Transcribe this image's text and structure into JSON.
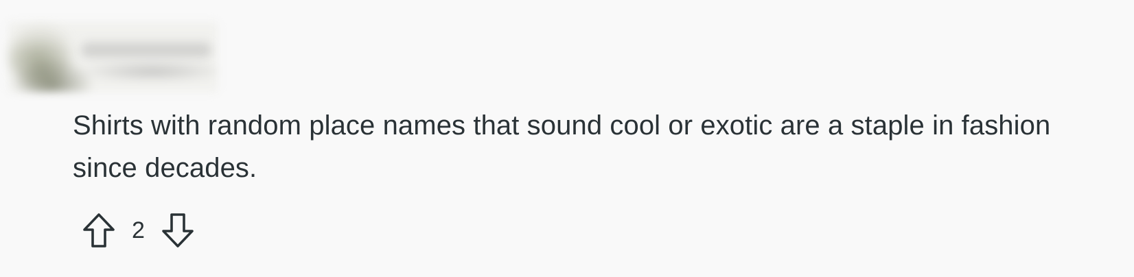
{
  "comment": {
    "author_redacted": true,
    "body": "Shirts with random place names that sound cool or exotic are a staple in fashion since decades.",
    "score": "2",
    "upvote_icon": "arrow-up-icon",
    "downvote_icon": "arrow-down-icon"
  },
  "colors": {
    "background": "#f9f9f9",
    "text": "#2a3236",
    "icon_stroke": "#2a3236"
  }
}
